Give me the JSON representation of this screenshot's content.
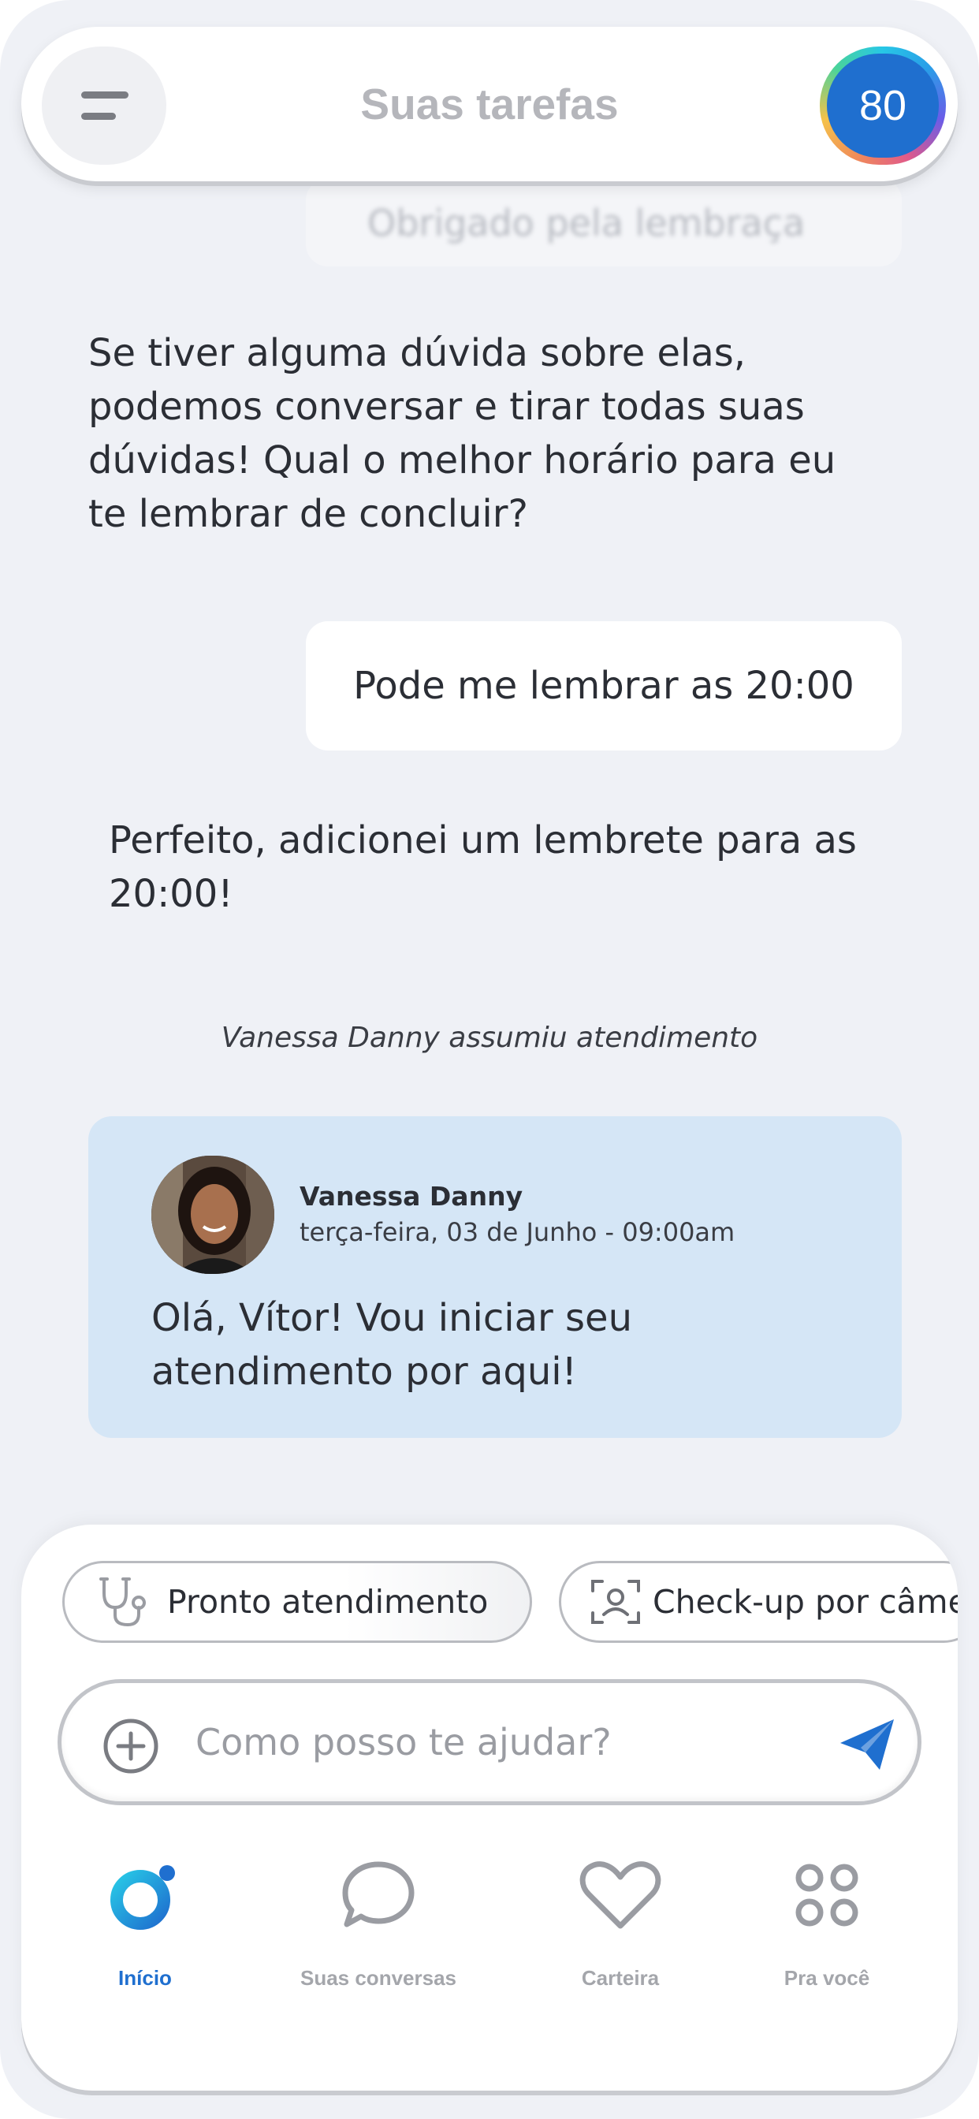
{
  "header": {
    "title": "Suas tarefas",
    "score": "80"
  },
  "chat": {
    "blurred_reply": "Obrigado pela lembraça",
    "bot_message_1": "Se tiver alguma dúvida sobre elas, podemos conversar e tirar todas suas dúvidas! Qual o melhor horário para eu te lembrar de concluir?",
    "user_message": "Pode me lembrar as 20:00",
    "bot_message_2": "Perfeito, adicionei um lembrete para as 20:00!",
    "system_note": "Vanessa Danny assumiu atendimento",
    "agent": {
      "name": "Vanessa Danny",
      "date": "terça-feira, 03 de Junho - 09:00am",
      "message": "Olá, Vítor! Vou iniciar seu atendimento por aqui!"
    }
  },
  "quick_actions": [
    {
      "label": "Pronto atendimento",
      "icon": "stethoscope-icon"
    },
    {
      "label": "Check-up por câmera",
      "icon": "face-scan-icon"
    }
  ],
  "composer": {
    "placeholder": "Como posso te ajudar?"
  },
  "nav": [
    {
      "label": "Início",
      "icon": "home-logo-icon",
      "active": true
    },
    {
      "label": "Suas conversas",
      "icon": "chat-bubble-icon",
      "active": false
    },
    {
      "label": "Carteira",
      "icon": "heart-icon",
      "active": false
    },
    {
      "label": "Pra você",
      "icon": "grid-icon",
      "active": false
    }
  ],
  "colors": {
    "accent": "#1f6fcf",
    "background": "#eff1f6",
    "agent_card": "#d5e6f6"
  }
}
